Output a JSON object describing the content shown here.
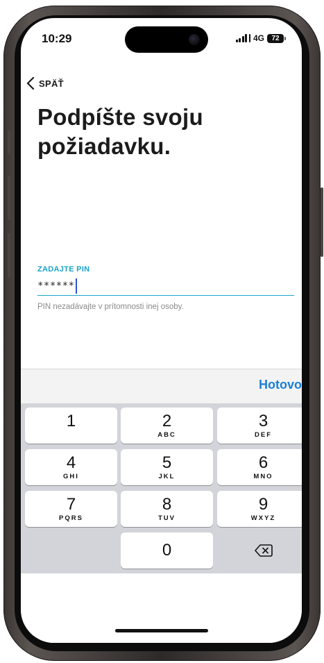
{
  "status_bar": {
    "time": "10:29",
    "network": "4G",
    "battery": "72"
  },
  "nav": {
    "back_label": "SPÄŤ"
  },
  "page": {
    "title": "Podpíšte svoju požiadavku."
  },
  "pin_field": {
    "label": "ZADAJTE PIN",
    "value": "******",
    "hint": "PIN nezadávajte v prítomnosti inej osoby."
  },
  "keyboard": {
    "done_label": "Hotovo",
    "keys": [
      {
        "digit": "1",
        "letters": ""
      },
      {
        "digit": "2",
        "letters": "ABC"
      },
      {
        "digit": "3",
        "letters": "DEF"
      },
      {
        "digit": "4",
        "letters": "GHI"
      },
      {
        "digit": "5",
        "letters": "JKL"
      },
      {
        "digit": "6",
        "letters": "MNO"
      },
      {
        "digit": "7",
        "letters": "PQRS"
      },
      {
        "digit": "8",
        "letters": "TUV"
      },
      {
        "digit": "9",
        "letters": "WXYZ"
      },
      {
        "digit": "0",
        "letters": ""
      }
    ]
  },
  "colors": {
    "accent": "#1aa3c8",
    "done": "#1a7fd6",
    "caret": "#2a52d8"
  }
}
